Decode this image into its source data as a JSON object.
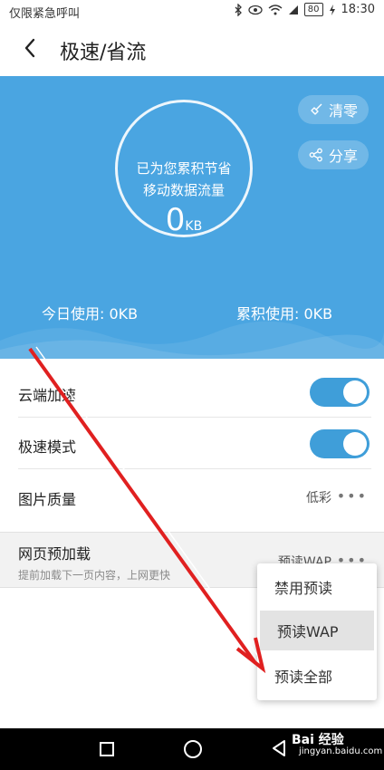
{
  "status_bar": {
    "carrier": "仅限紧急呼叫",
    "battery": "80",
    "time": "18:30"
  },
  "header": {
    "title": "极速/省流"
  },
  "summary": {
    "line1": "已为您累积节省",
    "line2": "移动数据流量",
    "saved_value": "0",
    "saved_unit": "KB",
    "clear_label": "清零",
    "share_label": "分享",
    "today_usage": "今日使用: 0KB",
    "total_usage": "累积使用: 0KB"
  },
  "settings": {
    "cloud_accel": {
      "label": "云端加速",
      "enabled": true
    },
    "speed_mode": {
      "label": "极速模式",
      "enabled": true
    },
    "image_quality": {
      "label": "图片质量",
      "value": "低彩",
      "more": "•••"
    },
    "page_preload": {
      "label": "网页预加载",
      "description": "提前加载下一页内容，上网更快",
      "value": "预读WAP",
      "more": "•••"
    }
  },
  "preload_menu": {
    "options": [
      "禁用预读",
      "预读WAP",
      "预读全部"
    ],
    "selected": "预读WAP"
  },
  "watermark": {
    "logo": "Bai 经验",
    "url": "jingyan.baidu.com"
  },
  "colors": {
    "hero_blue": "#4aa5e1",
    "toggle_on": "#3f9ed9",
    "annotation_red": "#e02020"
  }
}
